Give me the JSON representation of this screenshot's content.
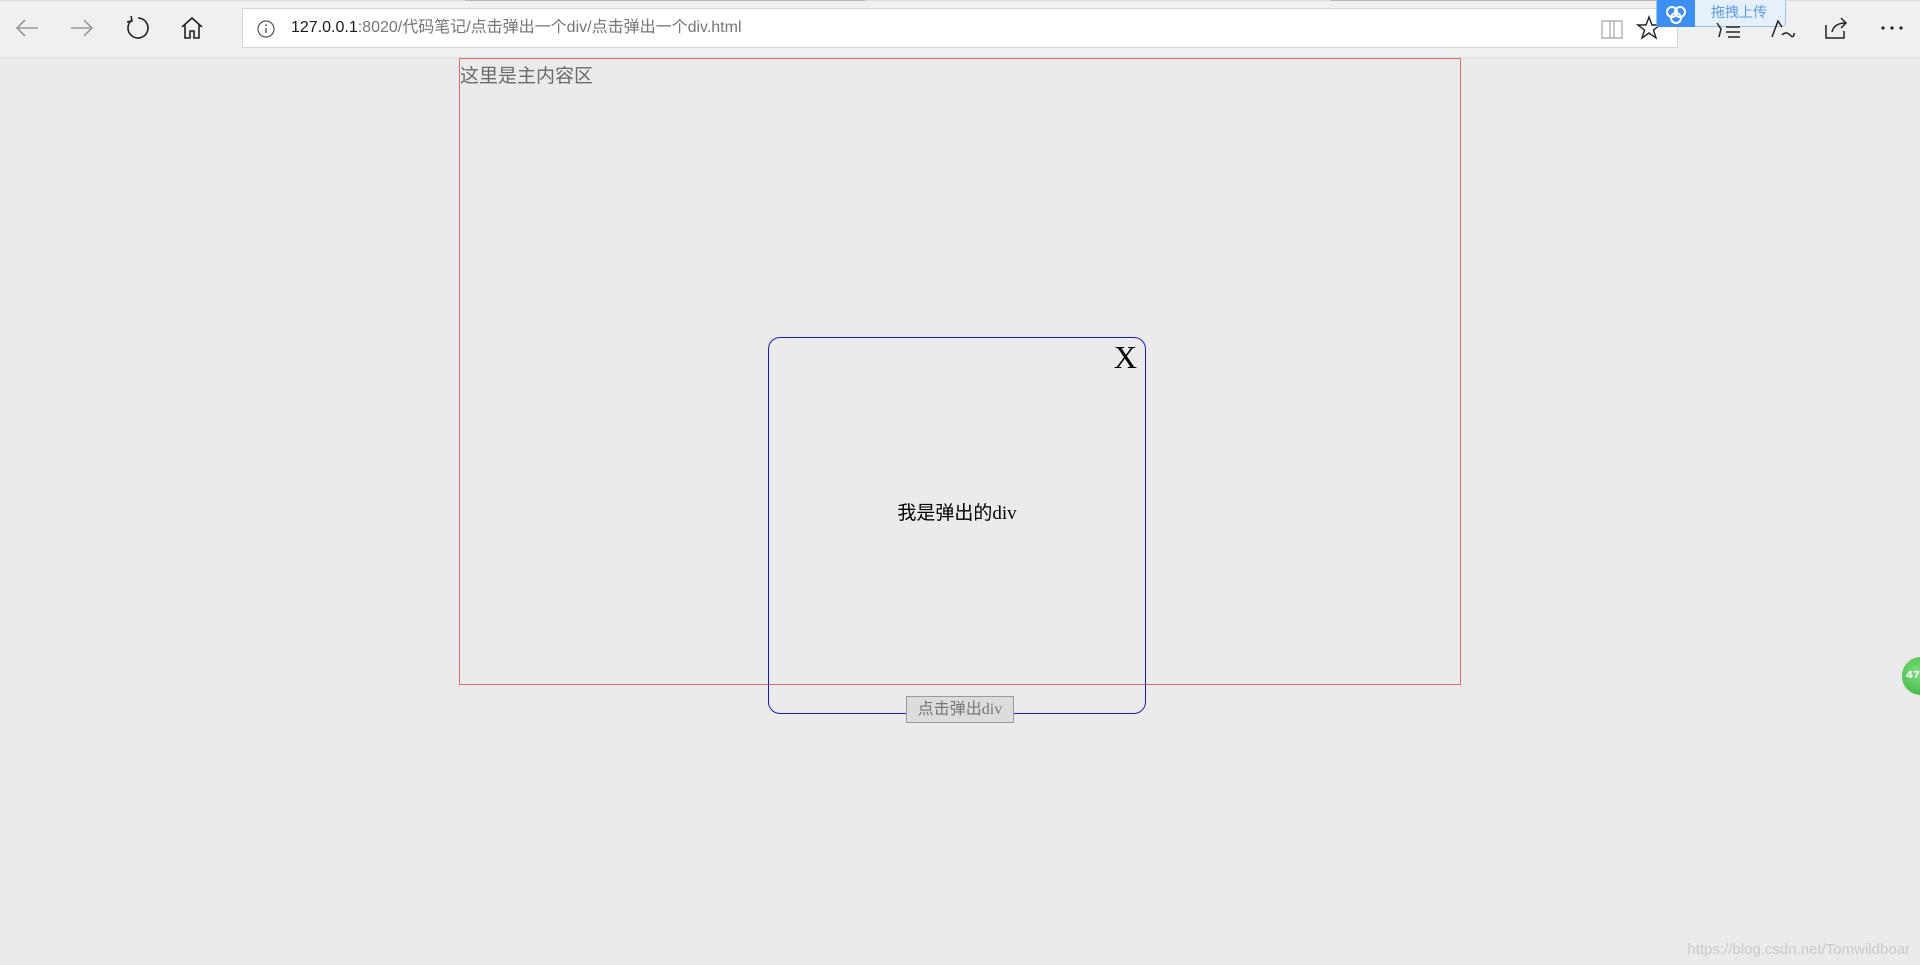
{
  "browser": {
    "url_host": "127.0.0.1",
    "url_rest": ":8020/代码笔记/点击弹出一个div/点击弹出一个div.html",
    "baidu_upload_label": "拖拽上传",
    "side_badge_text": "47"
  },
  "page": {
    "main_area_label": "这里是主内容区",
    "popup": {
      "close_label": "X",
      "message": "我是弹出的div"
    },
    "open_button_label": "点击弹出div",
    "watermark": "https://blog.csdn.net/Tomwildboar"
  },
  "colors": {
    "main_area_border": "#e86b6b",
    "popup_border": "#1a1acc",
    "page_background": "#ebebeb"
  }
}
